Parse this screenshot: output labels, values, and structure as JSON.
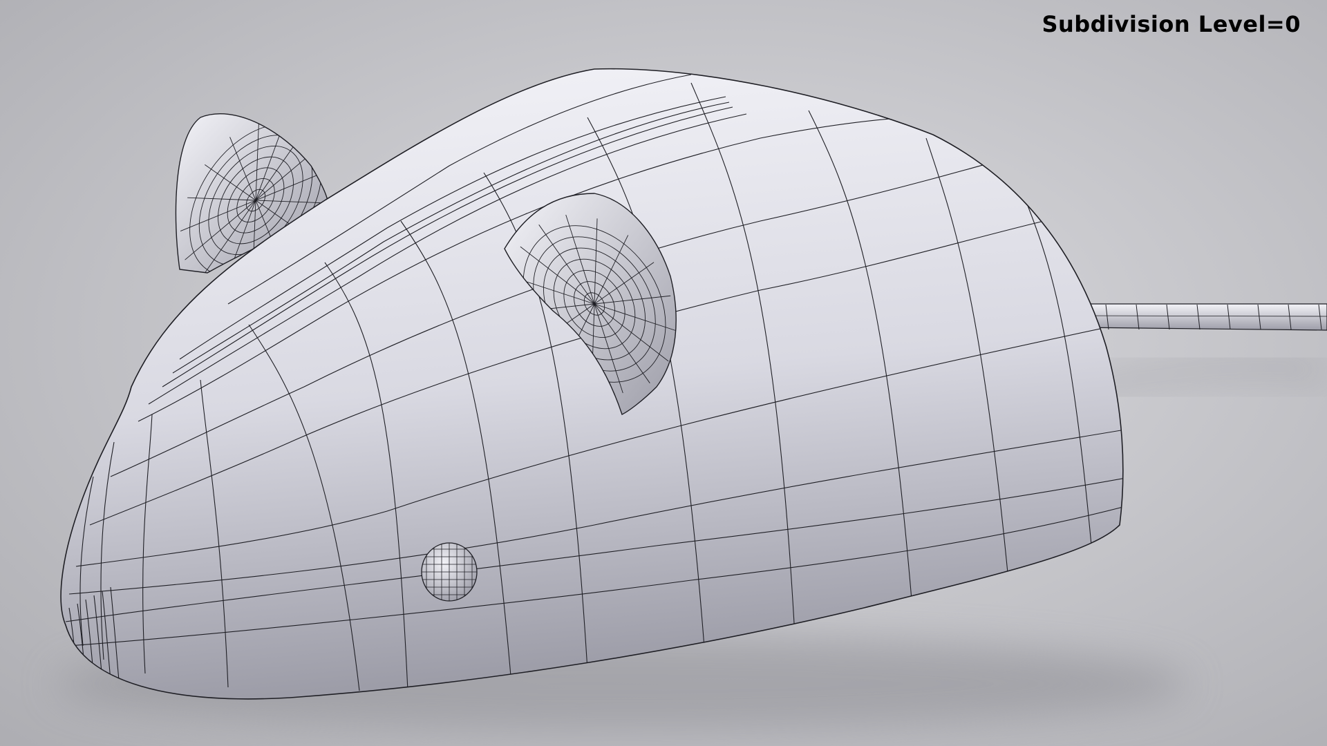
{
  "overlay": {
    "subdivision_label": "Subdivision Level=0"
  },
  "scene": {
    "subject": "mouse-wireframe-model",
    "colors": {
      "background_light": "#dcdce0",
      "background_dark": "#a9a9ae",
      "body_light": "#f3f3f8",
      "body_mid": "#d9d9e2",
      "body_dark": "#9d9da8",
      "wire": "#1e1e24",
      "shadow": "#8f8f95"
    }
  }
}
